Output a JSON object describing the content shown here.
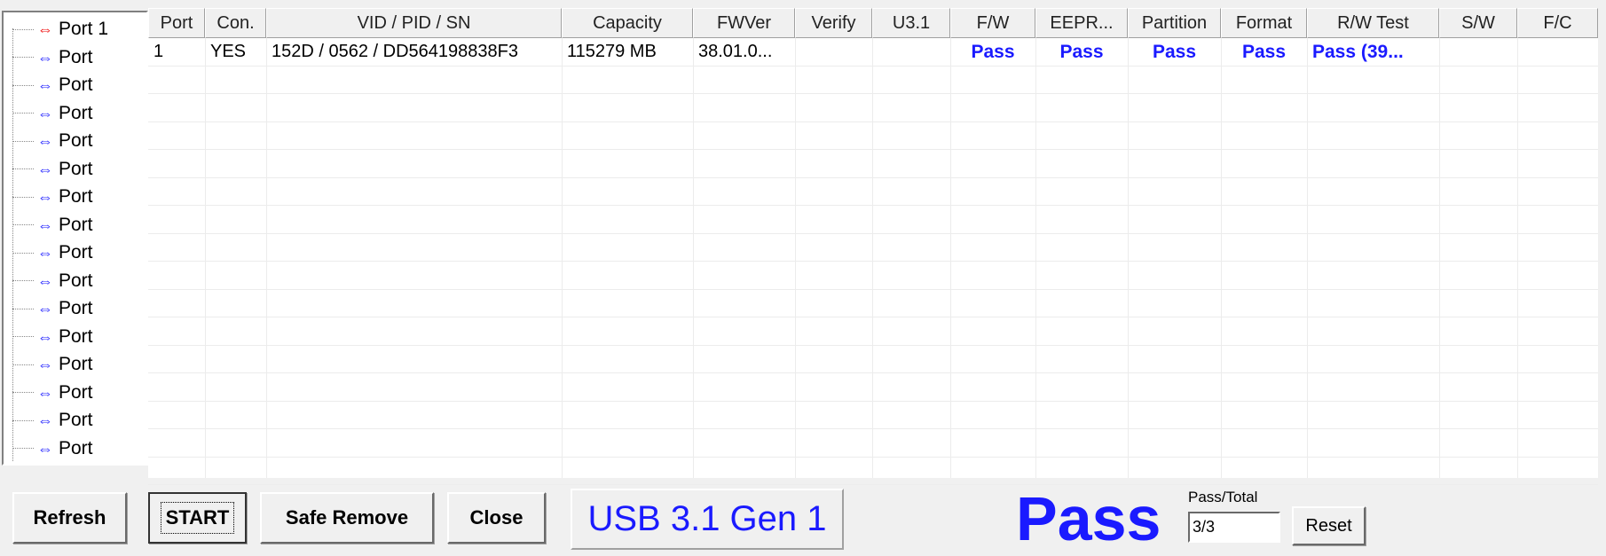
{
  "tree": {
    "items": [
      {
        "label": "Port 1",
        "icon": "usb-icon-red"
      },
      {
        "label": "Port",
        "icon": "usb-icon"
      },
      {
        "label": "Port",
        "icon": "usb-icon"
      },
      {
        "label": "Port",
        "icon": "usb-icon"
      },
      {
        "label": "Port",
        "icon": "usb-icon"
      },
      {
        "label": "Port",
        "icon": "usb-icon"
      },
      {
        "label": "Port",
        "icon": "usb-icon"
      },
      {
        "label": "Port",
        "icon": "usb-icon"
      },
      {
        "label": "Port",
        "icon": "usb-icon"
      },
      {
        "label": "Port",
        "icon": "usb-icon"
      },
      {
        "label": "Port",
        "icon": "usb-icon"
      },
      {
        "label": "Port",
        "icon": "usb-icon"
      },
      {
        "label": "Port",
        "icon": "usb-icon"
      },
      {
        "label": "Port",
        "icon": "usb-icon"
      },
      {
        "label": "Port",
        "icon": "usb-icon"
      },
      {
        "label": "Port",
        "icon": "usb-icon"
      }
    ]
  },
  "table": {
    "columns": [
      "Port",
      "Con.",
      "VID / PID / SN",
      "Capacity",
      "FWVer",
      "Verify",
      "U3.1",
      "F/W",
      "EEPR...",
      "Partition",
      "Format",
      "R/W Test",
      "S/W",
      "F/C"
    ],
    "rows": [
      [
        "1",
        "YES",
        "152D / 0562 / DD564198838F3",
        "115279 MB",
        "38.01.0...",
        "",
        "",
        "Pass",
        "Pass",
        "Pass",
        "Pass",
        "Pass (39...",
        "",
        ""
      ]
    ]
  },
  "buttons": {
    "refresh": "Refresh",
    "start": "START",
    "safe_remove": "Safe Remove",
    "close": "Close",
    "reset": "Reset"
  },
  "usb_mode": "USB 3.1 Gen 1",
  "result": "Pass",
  "pass_total": {
    "label": "Pass/Total",
    "value": "3/3"
  },
  "colors": {
    "pass": "#1a1aff",
    "active_port": "#e00000"
  }
}
